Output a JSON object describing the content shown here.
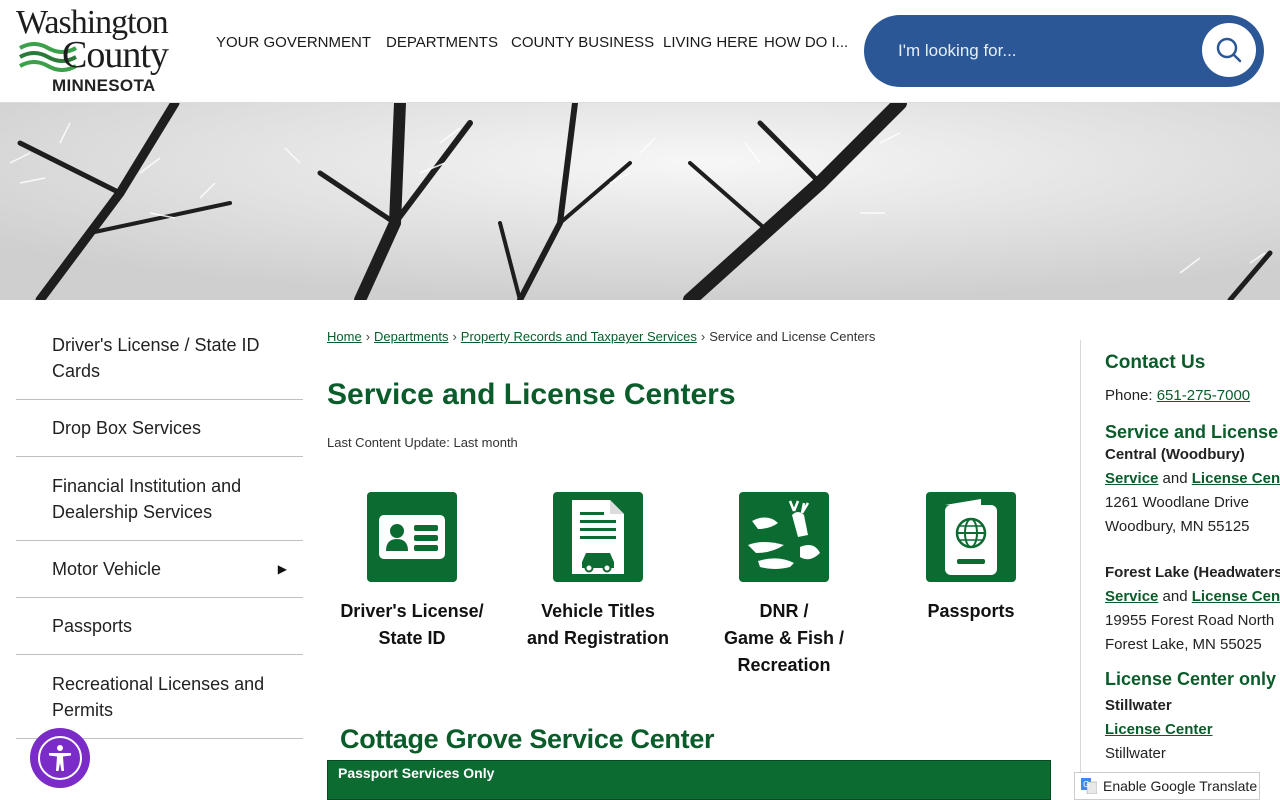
{
  "logo": {
    "line1": "Washington",
    "line2": "County",
    "line3": "MINNESOTA"
  },
  "nav": [
    "YOUR GOVERNMENT",
    "DEPARTMENTS",
    "COUNTY BUSINESS",
    "LIVING HERE",
    "HOW DO I..."
  ],
  "search": {
    "placeholder": "I'm looking for..."
  },
  "sidebar": [
    {
      "label": "Driver's License / State ID Cards"
    },
    {
      "label": "Drop Box Services"
    },
    {
      "label": "Financial Institution and Dealership Services"
    },
    {
      "label": "Motor Vehicle",
      "arrow": "▶"
    },
    {
      "label": "Passports"
    },
    {
      "label": "Recreational Licenses and Permits"
    }
  ],
  "breadcrumb": {
    "home": "Home",
    "departments": "Departments",
    "property": "Property Records and Taxpayer Services",
    "current": "Service and License Centers",
    "sep": "›"
  },
  "page": {
    "title": "Service and License Centers",
    "last_update": "Last Content Update: Last month"
  },
  "tiles": [
    {
      "label": "Driver's License/\nState ID",
      "icon": "id-card-icon"
    },
    {
      "label": "Vehicle Titles\nand Registration",
      "icon": "vehicle-document-icon"
    },
    {
      "label": "DNR /\nGame & Fish /\nRecreation",
      "icon": "wildlife-icon"
    },
    {
      "label": "Passports",
      "icon": "passport-icon"
    }
  ],
  "center": {
    "heading": "Cottage Grove Service Center",
    "bar": "Passport Services Only"
  },
  "contact": {
    "heading": "Contact Us",
    "phone_label": "Phone: ",
    "phone": "651-275-7000",
    "svc_heading": "Service and License Centers",
    "central_name": "Central (Woodbury)",
    "service": "Service",
    "and": " and ",
    "license_center": "License Center",
    "central_addr1": "1261 Woodlane Drive",
    "central_addr2": "Woodbury, MN 55125",
    "forest_name": "Forest Lake (Headwaters)",
    "forest_addr1": "19955 Forest Road North",
    "forest_addr2": "Forest Lake, MN 55025",
    "lc_heading": "License Center only",
    "still_name": "Stillwater",
    "still_link": "License Center",
    "still_addr1": "Stillwater"
  },
  "translate": {
    "label": "Enable Google Translate"
  },
  "colors": {
    "green": "#0b6b31",
    "blue": "#2b5797",
    "purple": "#7a2bc8"
  }
}
